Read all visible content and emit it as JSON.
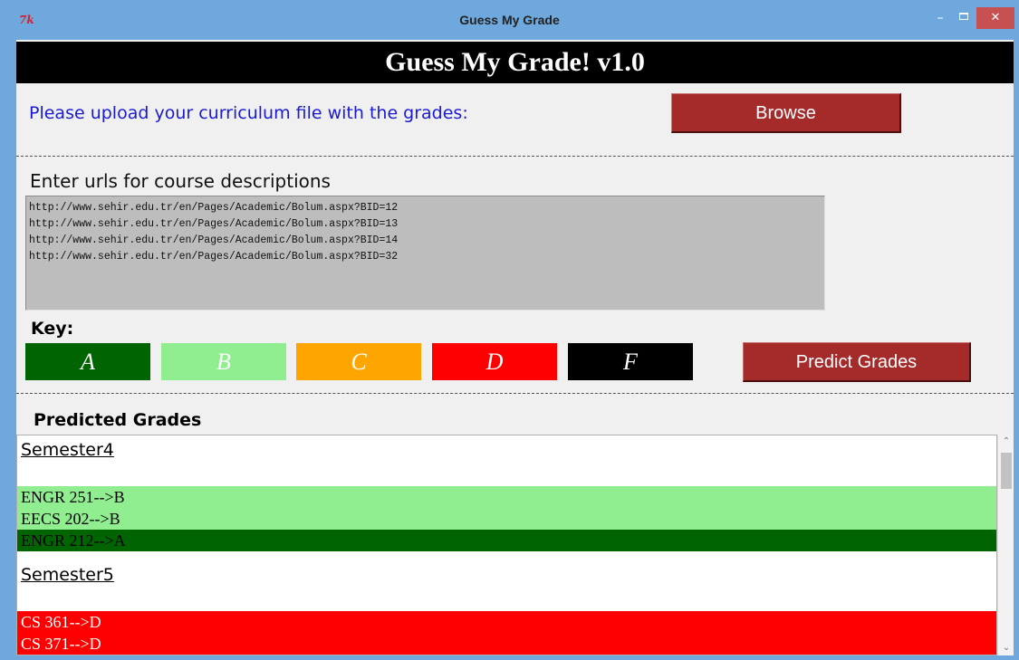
{
  "window": {
    "title": "Guess My Grade",
    "icon_text": "7k",
    "minimize": "–",
    "close": "✕"
  },
  "banner": {
    "title": "Guess My Grade! v1.0"
  },
  "upload": {
    "label": "Please upload your curriculum file with the grades:",
    "browse_label": "Browse"
  },
  "urls": {
    "label": "Enter urls for course descriptions",
    "value": "http://www.sehir.edu.tr/en/Pages/Academic/Bolum.aspx?BID=12\nhttp://www.sehir.edu.tr/en/Pages/Academic/Bolum.aspx?BID=13\nhttp://www.sehir.edu.tr/en/Pages/Academic/Bolum.aspx?BID=14\nhttp://www.sehir.edu.tr/en/Pages/Academic/Bolum.aspx?BID=32"
  },
  "key": {
    "label": "Key:",
    "items": [
      {
        "grade": "A",
        "bg": "#006400",
        "fg": "#ffffff"
      },
      {
        "grade": "B",
        "bg": "#90ee90",
        "fg": "#ffffff"
      },
      {
        "grade": "C",
        "bg": "#ffa500",
        "fg": "#ffffff"
      },
      {
        "grade": "D",
        "bg": "#ff0000",
        "fg": "#ffffff"
      },
      {
        "grade": "F",
        "bg": "#000000",
        "fg": "#ffffff"
      }
    ]
  },
  "predict": {
    "button_label": "Predict Grades"
  },
  "predicted": {
    "label": "Predicted Grades",
    "semesters": [
      {
        "name": "Semester4",
        "courses": [
          {
            "text": "ENGR 251-->B",
            "grade": "B",
            "bg": "#90ee90",
            "fg": "#000000"
          },
          {
            "text": "EECS 202-->B",
            "grade": "B",
            "bg": "#90ee90",
            "fg": "#000000"
          },
          {
            "text": "ENGR 212-->A",
            "grade": "A",
            "bg": "#006400",
            "fg": "#000000"
          }
        ]
      },
      {
        "name": "Semester5",
        "courses": [
          {
            "text": "CS 361-->D",
            "grade": "D",
            "bg": "#ff0000",
            "fg": "#ffffff"
          },
          {
            "text": "CS 371-->D",
            "grade": "D",
            "bg": "#ff0000",
            "fg": "#ffffff"
          }
        ]
      }
    ]
  },
  "colors": {
    "titlebar": "#6fa8dc",
    "button": "#a52a2a",
    "upload_label": "#1a1ad6",
    "urls_bg": "#bdbdbd"
  }
}
